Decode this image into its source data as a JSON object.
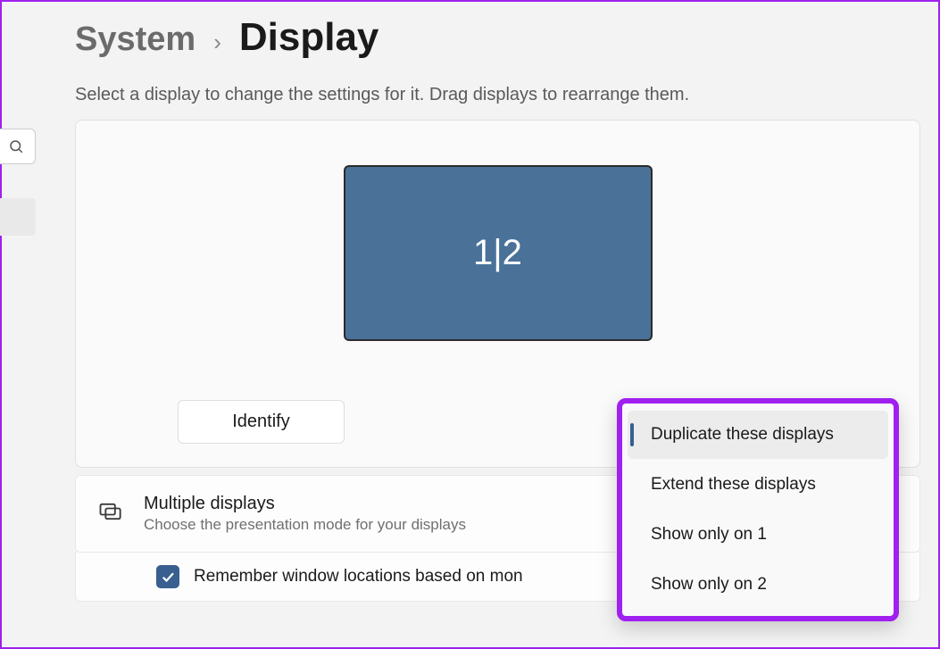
{
  "breadcrumb": {
    "parent": "System",
    "current": "Display"
  },
  "subtitle": "Select a display to change the settings for it. Drag displays to rearrange them.",
  "preview": {
    "monitor_label": "1|2",
    "identify_label": "Identify"
  },
  "multiple_displays": {
    "title": "Multiple displays",
    "description": "Choose the presentation mode for your displays"
  },
  "remember_locations": {
    "checked": true,
    "label": "Remember window locations based on mon"
  },
  "dropdown": {
    "options": [
      "Duplicate these displays",
      "Extend these displays",
      "Show only on 1",
      "Show only on 2"
    ],
    "selected_index": 0
  }
}
